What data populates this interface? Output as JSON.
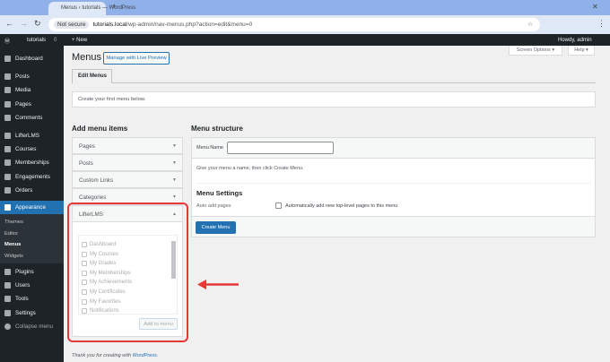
{
  "browser": {
    "tab_title": "Menus ‹ tutorials — WordPress",
    "not_secure": "Not secure",
    "url_host": "tutorials.local",
    "url_path": "/wp-admin/nav-menus.php?action=edit&menu=0"
  },
  "adminbar": {
    "site": "tutorials",
    "comments": "0",
    "new": "New",
    "howdy": "Howdy, admin"
  },
  "sidebar": {
    "items": [
      "Dashboard",
      "Posts",
      "Media",
      "Pages",
      "Comments",
      "LifterLMS",
      "Courses",
      "Memberships",
      "Engagements",
      "Orders",
      "Appearance",
      "Plugins",
      "Users",
      "Tools",
      "Settings",
      "Collapse menu"
    ],
    "submenu": [
      "Themes",
      "Editor",
      "Menus",
      "Widgets"
    ],
    "active": "Appearance",
    "active_color": "#2271b1"
  },
  "header": {
    "title": "Menus",
    "live_preview": "Manage with Live Preview",
    "screen_options": "Screen Options ▾",
    "help": "Help ▾",
    "tab": "Edit Menus"
  },
  "notice": "Create your first menu below.",
  "add_items": {
    "title": "Add menu items",
    "sections": [
      "Pages",
      "Posts",
      "Custom Links",
      "Categories",
      "LifterLMS"
    ],
    "lifter_items": [
      "Dashboard",
      "My Courses",
      "My Grades",
      "My Memberships",
      "My Achievements",
      "My Certificates",
      "My Favorites",
      "Notifications"
    ],
    "add_button": "Add to menu"
  },
  "structure": {
    "title": "Menu structure",
    "name_label": "Menu Name",
    "name_value": "",
    "hint": "Give your menu a name, then click Create Menu.",
    "settings_title": "Menu Settings",
    "auto_label": "Auto add pages",
    "auto_option": "Automatically add new top-level pages to this menu",
    "create_button": "Create Menu"
  },
  "footer": {
    "text": "Thank you for creating with ",
    "link": "WordPress",
    "end": "."
  },
  "annotation_color": "#e53935"
}
